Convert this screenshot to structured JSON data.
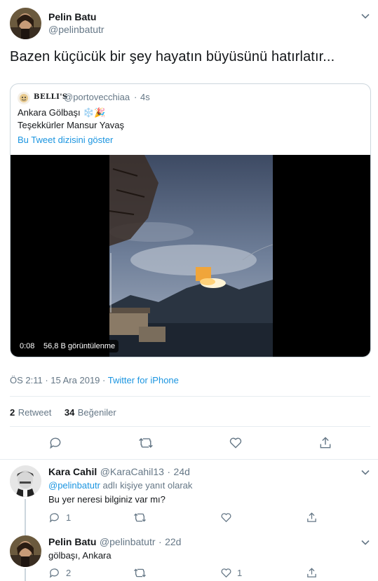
{
  "tweet": {
    "author_name": "Pelin Batu",
    "author_handle": "@pelinbatutr",
    "text": "Bazen küçücük bir şey hayatın büyüsünü hatırlatır...",
    "quoted": {
      "brand": "BELLI'S",
      "handle": "@portovecchiaa",
      "sep": "·",
      "time": "4s",
      "line1": "Ankara Gölbaşı ❄️🎉",
      "line2": "Teşekkürler Mansur Yavaş",
      "show_thread": "Bu Tweet dizisini göster",
      "video_time": "0:08",
      "video_views": "56,8 B görüntülenme"
    },
    "timestamp": "ÖS 2:11 · 15 Ara 2019",
    "source_sep": " · ",
    "source": "Twitter for iPhone",
    "retweet_count": "2",
    "retweet_label": "Retweet",
    "like_count": "34",
    "like_label": "Beğeniler"
  },
  "replies": [
    {
      "name": "Kara Cahil",
      "handle": "@KaraCahil13",
      "sep": "·",
      "time": "24d",
      "reply_to_handle": "@pelinbatutr",
      "reply_to_suffix": " adlı kişiye yanıt olarak",
      "text": "Bu yer neresi bilginiz var mı?",
      "reply_count": "1",
      "retweet_count": "",
      "like_count": ""
    },
    {
      "name": "Pelin Batu",
      "handle": "@pelinbatutr",
      "sep": "·",
      "time": "22d",
      "text": "gölbaşı, Ankara",
      "reply_count": "2",
      "retweet_count": "",
      "like_count": "1"
    }
  ],
  "colors": {
    "link": "#1b95e0",
    "muted": "#657786",
    "border": "#e6ecf0"
  }
}
